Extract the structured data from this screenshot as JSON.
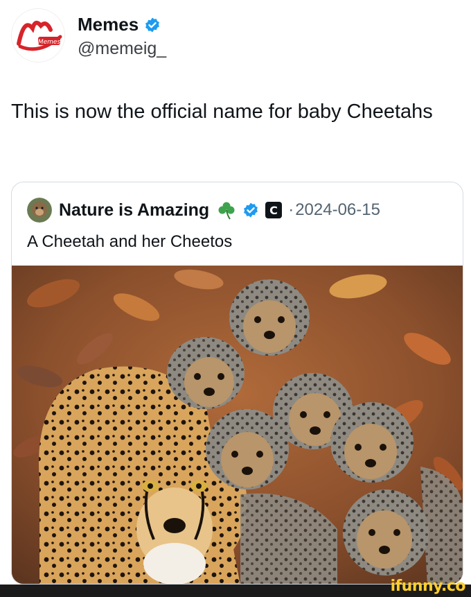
{
  "post": {
    "author_name": "Memes",
    "author_handle": "@memeig_",
    "verified_icon": "verified-badge-icon",
    "text": "This is now the official name for baby Cheetahs",
    "avatar_logo_text": "Memes"
  },
  "quote": {
    "author_name": "Nature is Amazing",
    "clover_emoji": "☘️",
    "verified_icon": "verified-badge-icon",
    "affiliate_badge": "C",
    "separator": "·",
    "date": "2024-06-15",
    "text": "A Cheetah and her Cheetos",
    "image_alt": "cheetah-with-cubs-photo"
  },
  "watermark": "ifunny.co",
  "colors": {
    "verified_blue": "#1d9bf0",
    "text_primary": "#0f1419",
    "text_secondary": "#536471",
    "watermark_yellow": "#ffcf2a",
    "logo_red": "#d6242a"
  }
}
